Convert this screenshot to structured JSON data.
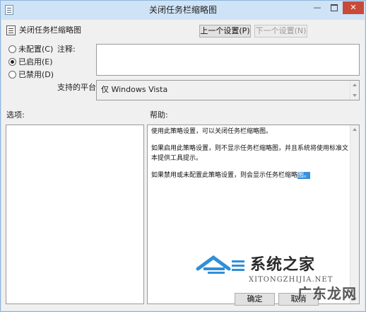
{
  "window": {
    "title": "关闭任务栏缩略图",
    "minimize_glyph": "—",
    "close_glyph": "✕"
  },
  "header": {
    "policy_name": "关闭任务栏缩略图",
    "prev_button": "上一个设置(P)",
    "next_button": "下一个设置(N)",
    "next_enabled": false
  },
  "state": {
    "options": [
      {
        "label": "未配置(C)",
        "selected": false
      },
      {
        "label": "已启用(E)",
        "selected": true
      },
      {
        "label": "已禁用(D)",
        "selected": false
      }
    ]
  },
  "comment": {
    "label": "注释:",
    "value": ""
  },
  "platform": {
    "label": "支持的平台:",
    "value": "仅 Windows Vista"
  },
  "options_section": {
    "label": "选项:"
  },
  "help": {
    "label": "帮助:",
    "paragraphs": [
      "使用此策略设置，可以关闭任务栏缩略图。",
      "如果启用此策略设置，则不显示任务栏缩略图，并且系统将使用标准文本提供工具提示。"
    ],
    "last_paragraph_main": "如果禁用或未配置此策略设置，则会显示任务栏缩略",
    "last_paragraph_selected": "图。"
  },
  "watermark": {
    "name": "系统之家",
    "url": "XITONGZHIJIA.NET",
    "site2": "广东龙网"
  },
  "footer": {
    "ok_button": "确定",
    "cancel_button": "取消"
  },
  "colors": {
    "accent": "#3b8edb",
    "title_bar": "#cfe3f6",
    "close": "#c94a3b",
    "logo_blue": "#2f8fd8"
  }
}
